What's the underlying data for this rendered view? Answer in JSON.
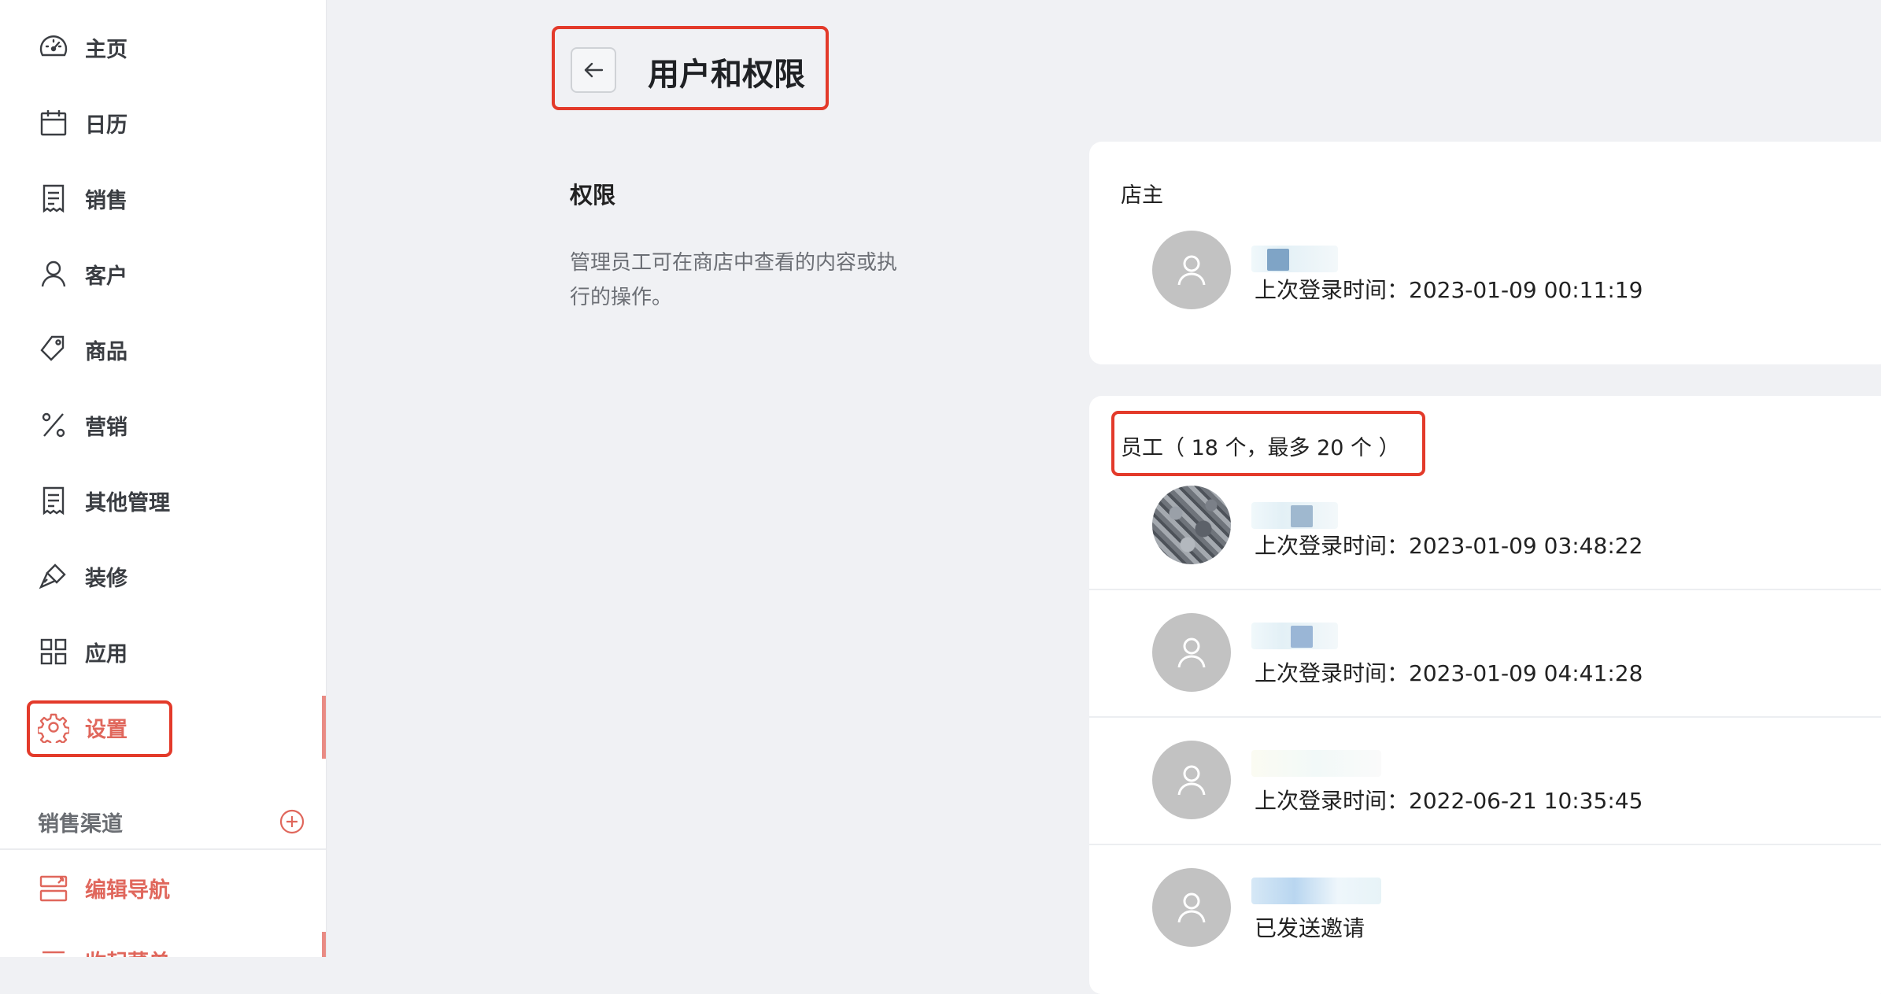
{
  "sidebar": {
    "items": [
      {
        "label": "主页",
        "icon": "dashboard-icon"
      },
      {
        "label": "日历",
        "icon": "calendar-icon"
      },
      {
        "label": "销售",
        "icon": "receipt-icon"
      },
      {
        "label": "客户",
        "icon": "user-icon"
      },
      {
        "label": "商品",
        "icon": "tag-icon"
      },
      {
        "label": "营销",
        "icon": "percent-icon"
      },
      {
        "label": "其他管理",
        "icon": "document-icon"
      },
      {
        "label": "装修",
        "icon": "brush-icon"
      },
      {
        "label": "应用",
        "icon": "grid-icon"
      },
      {
        "label": "设置",
        "icon": "gear-icon",
        "active": true
      }
    ],
    "sales_channels_title": "销售渠道",
    "channel_items": [
      {
        "label": "编辑导航",
        "icon": "navigation-icon"
      },
      {
        "label": "收起菜单",
        "icon": "menu-icon"
      }
    ]
  },
  "header": {
    "title": "用户和权限"
  },
  "permissions": {
    "title": "权限",
    "description": "管理员工可在商店中查看的内容或执行的操作。"
  },
  "owner_card": {
    "label": "店主",
    "owner": {
      "last_login": "上次登录时间：2023-01-09 00:11:19"
    }
  },
  "staff_card": {
    "label": "员工（ 18 个，最多 20 个 ）",
    "members": [
      {
        "status": "上次登录时间：2023-01-09 03:48:22",
        "avatar": "photo"
      },
      {
        "status": "上次登录时间：2023-01-09 04:41:28",
        "avatar": "default"
      },
      {
        "status": "上次登录时间：2022-06-21 10:35:45",
        "avatar": "default"
      },
      {
        "status": "已发送邀请",
        "avatar": "default"
      }
    ]
  },
  "colors": {
    "accent": "#e0675c",
    "highlight_border": "#e33a2a",
    "avatar_bg": "#c2c2c2"
  }
}
